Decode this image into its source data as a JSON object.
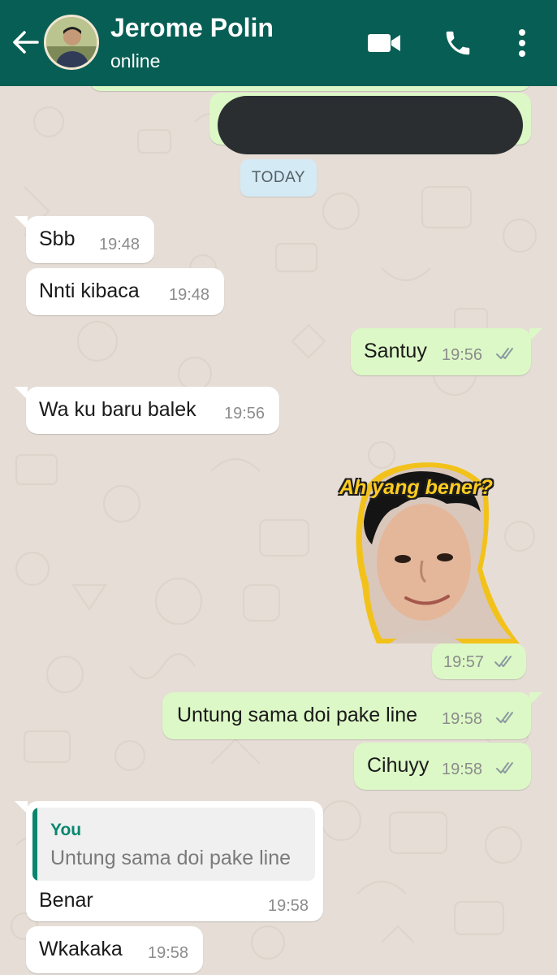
{
  "header": {
    "contact_name": "Jerome Polin",
    "status": "online"
  },
  "colors": {
    "header_bg": "#075e54",
    "incoming_bubble": "#ffffff",
    "outgoing_bubble": "#dcf8c6",
    "read_ticks": "#8fb8c8",
    "quote_accent": "#07866f"
  },
  "icons": {
    "back": "arrow-left-icon",
    "video": "video-camera-icon",
    "call": "phone-icon",
    "menu": "more-vertical-icon"
  },
  "date_separator": "TODAY",
  "messages": [
    {
      "direction": "in",
      "text": "Sbb",
      "time": "19:48"
    },
    {
      "direction": "in",
      "text": "Nnti kibaca",
      "time": "19:48"
    },
    {
      "direction": "out",
      "text": "Santuy",
      "time": "19:56",
      "status": "read"
    },
    {
      "direction": "in",
      "text": "Wa ku baru balek",
      "time": "19:56"
    },
    {
      "direction": "out",
      "type": "sticker",
      "caption": "Ah yang bener?",
      "time": "19:57",
      "status": "read"
    },
    {
      "direction": "out",
      "text": "Untung sama doi pake line",
      "time": "19:58",
      "status": "read"
    },
    {
      "direction": "out",
      "text": "Cihuyy",
      "time": "19:58",
      "status": "read"
    },
    {
      "direction": "in",
      "text": "Benar",
      "time": "19:58",
      "quote": {
        "sender": "You",
        "text": "Untung sama doi pake line"
      }
    },
    {
      "direction": "in",
      "text": "Wkakaka",
      "time": "19:58"
    }
  ]
}
